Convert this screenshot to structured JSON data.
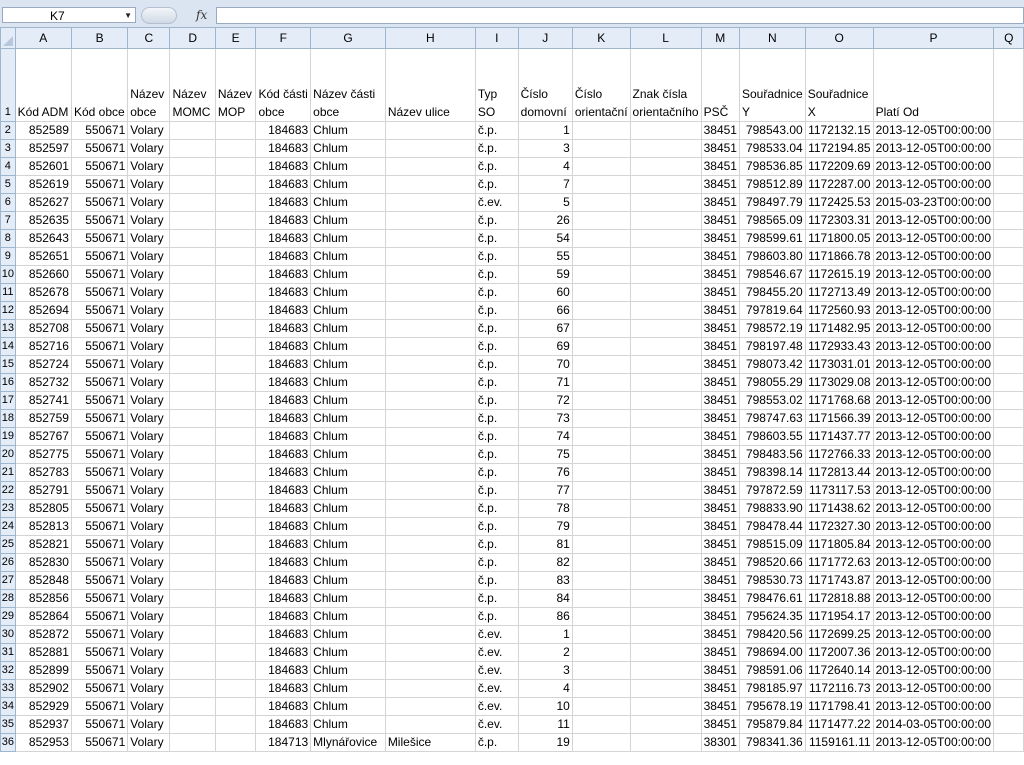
{
  "formula_bar": {
    "name_box": "K7",
    "fx_label": "fx",
    "formula": ""
  },
  "columns": [
    "A",
    "B",
    "C",
    "D",
    "E",
    "F",
    "G",
    "H",
    "I",
    "J",
    "K",
    "L",
    "M",
    "N",
    "O",
    "P",
    "Q"
  ],
  "headers": [
    "Kód ADM",
    "Kód obce",
    "Název obce",
    "Název MOMC",
    "Název MOP",
    "Kód části obce",
    "Název části obce",
    "Název ulice",
    "Typ SO",
    "Číslo domovní",
    "Číslo orientační",
    "Znak čísla orientačního",
    "PSČ",
    "Souřadnice Y",
    "Souřadnice X",
    "Platí Od",
    ""
  ],
  "rows": [
    [
      "852589",
      "550671",
      "Volary",
      "",
      "",
      "184683",
      "Chlum",
      "",
      "č.p.",
      "1",
      "",
      "",
      "38451",
      "798543.00",
      "1172132.15",
      "2013-12-05T00:00:00"
    ],
    [
      "852597",
      "550671",
      "Volary",
      "",
      "",
      "184683",
      "Chlum",
      "",
      "č.p.",
      "3",
      "",
      "",
      "38451",
      "798533.04",
      "1172194.85",
      "2013-12-05T00:00:00"
    ],
    [
      "852601",
      "550671",
      "Volary",
      "",
      "",
      "184683",
      "Chlum",
      "",
      "č.p.",
      "4",
      "",
      "",
      "38451",
      "798536.85",
      "1172209.69",
      "2013-12-05T00:00:00"
    ],
    [
      "852619",
      "550671",
      "Volary",
      "",
      "",
      "184683",
      "Chlum",
      "",
      "č.p.",
      "7",
      "",
      "",
      "38451",
      "798512.89",
      "1172287.00",
      "2013-12-05T00:00:00"
    ],
    [
      "852627",
      "550671",
      "Volary",
      "",
      "",
      "184683",
      "Chlum",
      "",
      "č.ev.",
      "5",
      "",
      "",
      "38451",
      "798497.79",
      "1172425.53",
      "2015-03-23T00:00:00"
    ],
    [
      "852635",
      "550671",
      "Volary",
      "",
      "",
      "184683",
      "Chlum",
      "",
      "č.p.",
      "26",
      "",
      "",
      "38451",
      "798565.09",
      "1172303.31",
      "2013-12-05T00:00:00"
    ],
    [
      "852643",
      "550671",
      "Volary",
      "",
      "",
      "184683",
      "Chlum",
      "",
      "č.p.",
      "54",
      "",
      "",
      "38451",
      "798599.61",
      "1171800.05",
      "2013-12-05T00:00:00"
    ],
    [
      "852651",
      "550671",
      "Volary",
      "",
      "",
      "184683",
      "Chlum",
      "",
      "č.p.",
      "55",
      "",
      "",
      "38451",
      "798603.80",
      "1171866.78",
      "2013-12-05T00:00:00"
    ],
    [
      "852660",
      "550671",
      "Volary",
      "",
      "",
      "184683",
      "Chlum",
      "",
      "č.p.",
      "59",
      "",
      "",
      "38451",
      "798546.67",
      "1172615.19",
      "2013-12-05T00:00:00"
    ],
    [
      "852678",
      "550671",
      "Volary",
      "",
      "",
      "184683",
      "Chlum",
      "",
      "č.p.",
      "60",
      "",
      "",
      "38451",
      "798455.20",
      "1172713.49",
      "2013-12-05T00:00:00"
    ],
    [
      "852694",
      "550671",
      "Volary",
      "",
      "",
      "184683",
      "Chlum",
      "",
      "č.p.",
      "66",
      "",
      "",
      "38451",
      "797819.64",
      "1172560.93",
      "2013-12-05T00:00:00"
    ],
    [
      "852708",
      "550671",
      "Volary",
      "",
      "",
      "184683",
      "Chlum",
      "",
      "č.p.",
      "67",
      "",
      "",
      "38451",
      "798572.19",
      "1171482.95",
      "2013-12-05T00:00:00"
    ],
    [
      "852716",
      "550671",
      "Volary",
      "",
      "",
      "184683",
      "Chlum",
      "",
      "č.p.",
      "69",
      "",
      "",
      "38451",
      "798197.48",
      "1172933.43",
      "2013-12-05T00:00:00"
    ],
    [
      "852724",
      "550671",
      "Volary",
      "",
      "",
      "184683",
      "Chlum",
      "",
      "č.p.",
      "70",
      "",
      "",
      "38451",
      "798073.42",
      "1173031.01",
      "2013-12-05T00:00:00"
    ],
    [
      "852732",
      "550671",
      "Volary",
      "",
      "",
      "184683",
      "Chlum",
      "",
      "č.p.",
      "71",
      "",
      "",
      "38451",
      "798055.29",
      "1173029.08",
      "2013-12-05T00:00:00"
    ],
    [
      "852741",
      "550671",
      "Volary",
      "",
      "",
      "184683",
      "Chlum",
      "",
      "č.p.",
      "72",
      "",
      "",
      "38451",
      "798553.02",
      "1171768.68",
      "2013-12-05T00:00:00"
    ],
    [
      "852759",
      "550671",
      "Volary",
      "",
      "",
      "184683",
      "Chlum",
      "",
      "č.p.",
      "73",
      "",
      "",
      "38451",
      "798747.63",
      "1171566.39",
      "2013-12-05T00:00:00"
    ],
    [
      "852767",
      "550671",
      "Volary",
      "",
      "",
      "184683",
      "Chlum",
      "",
      "č.p.",
      "74",
      "",
      "",
      "38451",
      "798603.55",
      "1171437.77",
      "2013-12-05T00:00:00"
    ],
    [
      "852775",
      "550671",
      "Volary",
      "",
      "",
      "184683",
      "Chlum",
      "",
      "č.p.",
      "75",
      "",
      "",
      "38451",
      "798483.56",
      "1172766.33",
      "2013-12-05T00:00:00"
    ],
    [
      "852783",
      "550671",
      "Volary",
      "",
      "",
      "184683",
      "Chlum",
      "",
      "č.p.",
      "76",
      "",
      "",
      "38451",
      "798398.14",
      "1172813.44",
      "2013-12-05T00:00:00"
    ],
    [
      "852791",
      "550671",
      "Volary",
      "",
      "",
      "184683",
      "Chlum",
      "",
      "č.p.",
      "77",
      "",
      "",
      "38451",
      "797872.59",
      "1173117.53",
      "2013-12-05T00:00:00"
    ],
    [
      "852805",
      "550671",
      "Volary",
      "",
      "",
      "184683",
      "Chlum",
      "",
      "č.p.",
      "78",
      "",
      "",
      "38451",
      "798833.90",
      "1171438.62",
      "2013-12-05T00:00:00"
    ],
    [
      "852813",
      "550671",
      "Volary",
      "",
      "",
      "184683",
      "Chlum",
      "",
      "č.p.",
      "79",
      "",
      "",
      "38451",
      "798478.44",
      "1172327.30",
      "2013-12-05T00:00:00"
    ],
    [
      "852821",
      "550671",
      "Volary",
      "",
      "",
      "184683",
      "Chlum",
      "",
      "č.p.",
      "81",
      "",
      "",
      "38451",
      "798515.09",
      "1171805.84",
      "2013-12-05T00:00:00"
    ],
    [
      "852830",
      "550671",
      "Volary",
      "",
      "",
      "184683",
      "Chlum",
      "",
      "č.p.",
      "82",
      "",
      "",
      "38451",
      "798520.66",
      "1171772.63",
      "2013-12-05T00:00:00"
    ],
    [
      "852848",
      "550671",
      "Volary",
      "",
      "",
      "184683",
      "Chlum",
      "",
      "č.p.",
      "83",
      "",
      "",
      "38451",
      "798530.73",
      "1171743.87",
      "2013-12-05T00:00:00"
    ],
    [
      "852856",
      "550671",
      "Volary",
      "",
      "",
      "184683",
      "Chlum",
      "",
      "č.p.",
      "84",
      "",
      "",
      "38451",
      "798476.61",
      "1172818.88",
      "2013-12-05T00:00:00"
    ],
    [
      "852864",
      "550671",
      "Volary",
      "",
      "",
      "184683",
      "Chlum",
      "",
      "č.p.",
      "86",
      "",
      "",
      "38451",
      "795624.35",
      "1171954.17",
      "2013-12-05T00:00:00"
    ],
    [
      "852872",
      "550671",
      "Volary",
      "",
      "",
      "184683",
      "Chlum",
      "",
      "č.ev.",
      "1",
      "",
      "",
      "38451",
      "798420.56",
      "1172699.25",
      "2013-12-05T00:00:00"
    ],
    [
      "852881",
      "550671",
      "Volary",
      "",
      "",
      "184683",
      "Chlum",
      "",
      "č.ev.",
      "2",
      "",
      "",
      "38451",
      "798694.00",
      "1172007.36",
      "2013-12-05T00:00:00"
    ],
    [
      "852899",
      "550671",
      "Volary",
      "",
      "",
      "184683",
      "Chlum",
      "",
      "č.ev.",
      "3",
      "",
      "",
      "38451",
      "798591.06",
      "1172640.14",
      "2013-12-05T00:00:00"
    ],
    [
      "852902",
      "550671",
      "Volary",
      "",
      "",
      "184683",
      "Chlum",
      "",
      "č.ev.",
      "4",
      "",
      "",
      "38451",
      "798185.97",
      "1172116.73",
      "2013-12-05T00:00:00"
    ],
    [
      "852929",
      "550671",
      "Volary",
      "",
      "",
      "184683",
      "Chlum",
      "",
      "č.ev.",
      "10",
      "",
      "",
      "38451",
      "795678.19",
      "1171798.41",
      "2013-12-05T00:00:00"
    ],
    [
      "852937",
      "550671",
      "Volary",
      "",
      "",
      "184683",
      "Chlum",
      "",
      "č.ev.",
      "11",
      "",
      "",
      "38451",
      "795879.84",
      "1171477.22",
      "2014-03-05T00:00:00"
    ],
    [
      "852953",
      "550671",
      "Volary",
      "",
      "",
      "184713",
      "Mlynářovice",
      "Milešice",
      "č.p.",
      "19",
      "",
      "",
      "38301",
      "798341.36",
      "1159161.11",
      "2013-12-05T00:00:00"
    ]
  ]
}
